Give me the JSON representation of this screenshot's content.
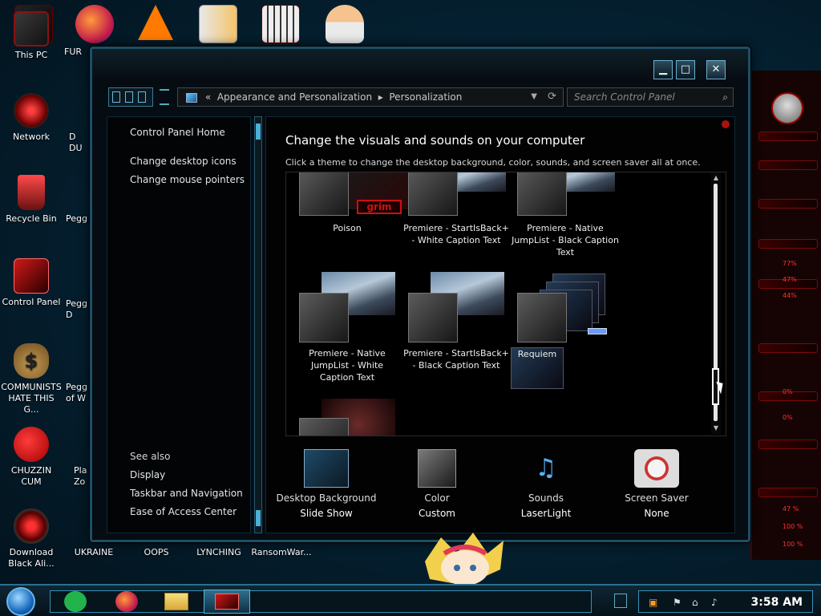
{
  "desktop": {
    "left_icons": [
      {
        "label": "This PC",
        "icon": "pc-icon"
      },
      {
        "label": "Network",
        "icon": "network-icon"
      },
      {
        "label": "Recycle Bin",
        "icon": "recycle-bin-icon"
      },
      {
        "label": "Control Panel",
        "icon": "control-panel-icon"
      },
      {
        "label": "COMMUNISTS HATE THIS G...",
        "icon": "money-bag-icon"
      },
      {
        "label": "CHUZZIN CUM",
        "icon": "chuzzle-icon"
      },
      {
        "label": "Download Black Ali...",
        "icon": "download-icon"
      }
    ],
    "second_column": [
      "FUR",
      "D DU",
      "Pegg",
      "Pegg D",
      "Pegg of W",
      "Pla Zo"
    ],
    "bottom_row": [
      "UKRAINE",
      "OOPS",
      "LYNCHING",
      "RansomWar..."
    ]
  },
  "right_panel": {
    "percents": [
      "77%",
      "47%",
      "44%",
      "0%",
      "0%",
      "47 %",
      "100 %",
      "100 %"
    ]
  },
  "window": {
    "controls": {
      "minimize": "▁",
      "maximize": "□",
      "close": "✕"
    },
    "address": {
      "segments": [
        "«",
        "Appearance and Personalization",
        "▸",
        "Personalization"
      ]
    },
    "search": {
      "placeholder": "Search Control Panel"
    },
    "sidebar": {
      "home": "Control Panel Home",
      "links": [
        "Change desktop icons",
        "Change mouse pointers"
      ],
      "see_also": "See also",
      "see_also_links": [
        "Display",
        "Taskbar and Navigation",
        "Ease of Access Center"
      ]
    },
    "main": {
      "title": "Change the visuals and sounds on your computer",
      "subtitle": "Click a theme to change the desktop background, color, sounds, and screen saver all at once.",
      "themes": [
        {
          "name": "Poison",
          "logo": "grim"
        },
        {
          "name": "Premiere - StartIsBack+ - White Caption Text"
        },
        {
          "name": "Premiere - Native JumpList - Black Caption Text"
        },
        {
          "name": "Premiere - Native JumpList - White Caption Text"
        },
        {
          "name": "Premiere - StartIsBack+ - Black Caption Text"
        },
        {
          "name": "Requiem"
        },
        {
          "name": ""
        }
      ],
      "bottom": [
        {
          "label": "Desktop Background",
          "value": "Slide Show"
        },
        {
          "label": "Color",
          "value": "Custom"
        },
        {
          "label": "Sounds",
          "value": "LaserLight"
        },
        {
          "label": "Screen Saver",
          "value": "None"
        }
      ]
    }
  },
  "taskbar": {
    "clock": "3:58 AM"
  }
}
